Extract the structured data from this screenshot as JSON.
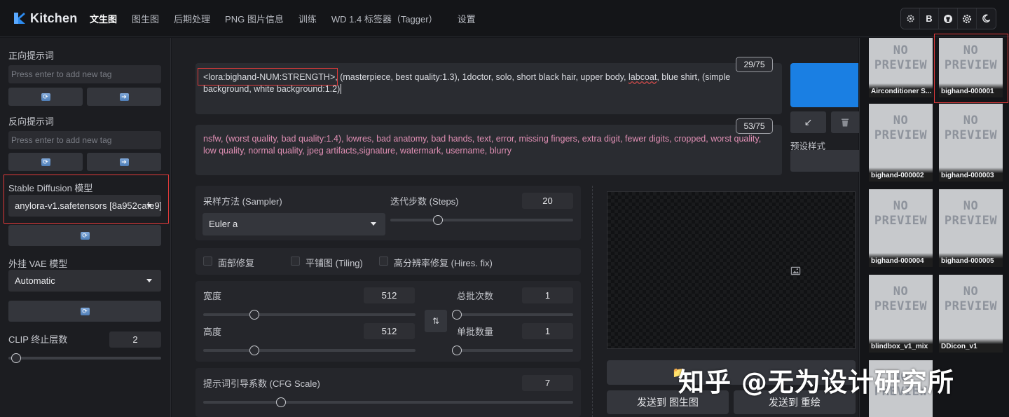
{
  "app": {
    "name": "Kitchen"
  },
  "nav": [
    {
      "label": "文生图",
      "active": true
    },
    {
      "label": "图生图",
      "active": false
    },
    {
      "label": "后期处理",
      "active": false
    },
    {
      "label": "PNG 图片信息",
      "active": false
    },
    {
      "label": "训练",
      "active": false
    },
    {
      "label": "WD 1.4 标签器（Tagger）",
      "active": false
    },
    {
      "label": "设置",
      "active": false
    }
  ],
  "top_icons": {
    "b_label": "B"
  },
  "sidebar": {
    "positive_label": "正向提示词",
    "positive_placeholder": "Press enter to add new tag",
    "negative_label": "反向提示词",
    "negative_placeholder": "Press enter to add new tag",
    "sd_model_label": "Stable Diffusion 模型",
    "sd_model_value": "anylora-v1.safetensors [8a952cafe9]",
    "vae_label": "外挂 VAE 模型",
    "vae_value": "Automatic",
    "clip_label": "CLIP 终止层数",
    "clip_value": "2",
    "clip_slider": 0.05
  },
  "prompt": {
    "lora_tag": "<lora:bighand-NUM:STRENGTH>",
    "text_before_underline": ", (masterpiece, best quality:1.3), 1doctor, solo, short black hair, upper body, ",
    "underlined": "labcoat",
    "text_after_underline": ", blue shirt, (simple background, white background:1.2)",
    "counter": "29/75"
  },
  "negative": {
    "text": "nsfw, (worst quality, bad quality:1.4), lowres, bad anatomy, bad hands, text, error, missing fingers, extra digit, fewer digits, cropped, worst quality, low quality, normal quality, jpeg artifacts,signature, watermark, username, blurry",
    "counter": "53/75"
  },
  "sampler": {
    "label": "采样方法 (Sampler)",
    "value": "Euler a"
  },
  "steps": {
    "label": "迭代步数 (Steps)",
    "value": "20",
    "slider": 0.26
  },
  "checks": {
    "face": "面部修复",
    "tiling": "平铺图 (Tiling)",
    "hires": "高分辨率修复 (Hires. fix)"
  },
  "width": {
    "label": "宽度",
    "value": "512",
    "slider": 0.24
  },
  "height": {
    "label": "高度",
    "value": "512",
    "slider": 0.24
  },
  "batch_count": {
    "label": "总批次数",
    "value": "1",
    "slider": 0.0
  },
  "batch_size": {
    "label": "单批数量",
    "value": "1",
    "slider": 0.0
  },
  "cfg": {
    "label": "提示词引导系数 (CFG Scale)",
    "value": "7",
    "slider": 0.21
  },
  "styles": {
    "label": "预设样式"
  },
  "actions": {
    "send_img2img": "发送到 图生图",
    "send_inpaint": "发送到 重绘"
  },
  "gallery": {
    "no_preview": "NO\nPREVIEW",
    "items": [
      "Airconditioner S...",
      "bighand-000001",
      "bighand-000002",
      "bighand-000003",
      "bighand-000004",
      "bighand-000005",
      "blindbox_v1_mix",
      "DDicon_v1",
      ""
    ]
  },
  "colors": {
    "accent": "#1a7fe3",
    "highlight": "#e03a3a"
  },
  "watermark": "知乎 @无为设计研究所"
}
